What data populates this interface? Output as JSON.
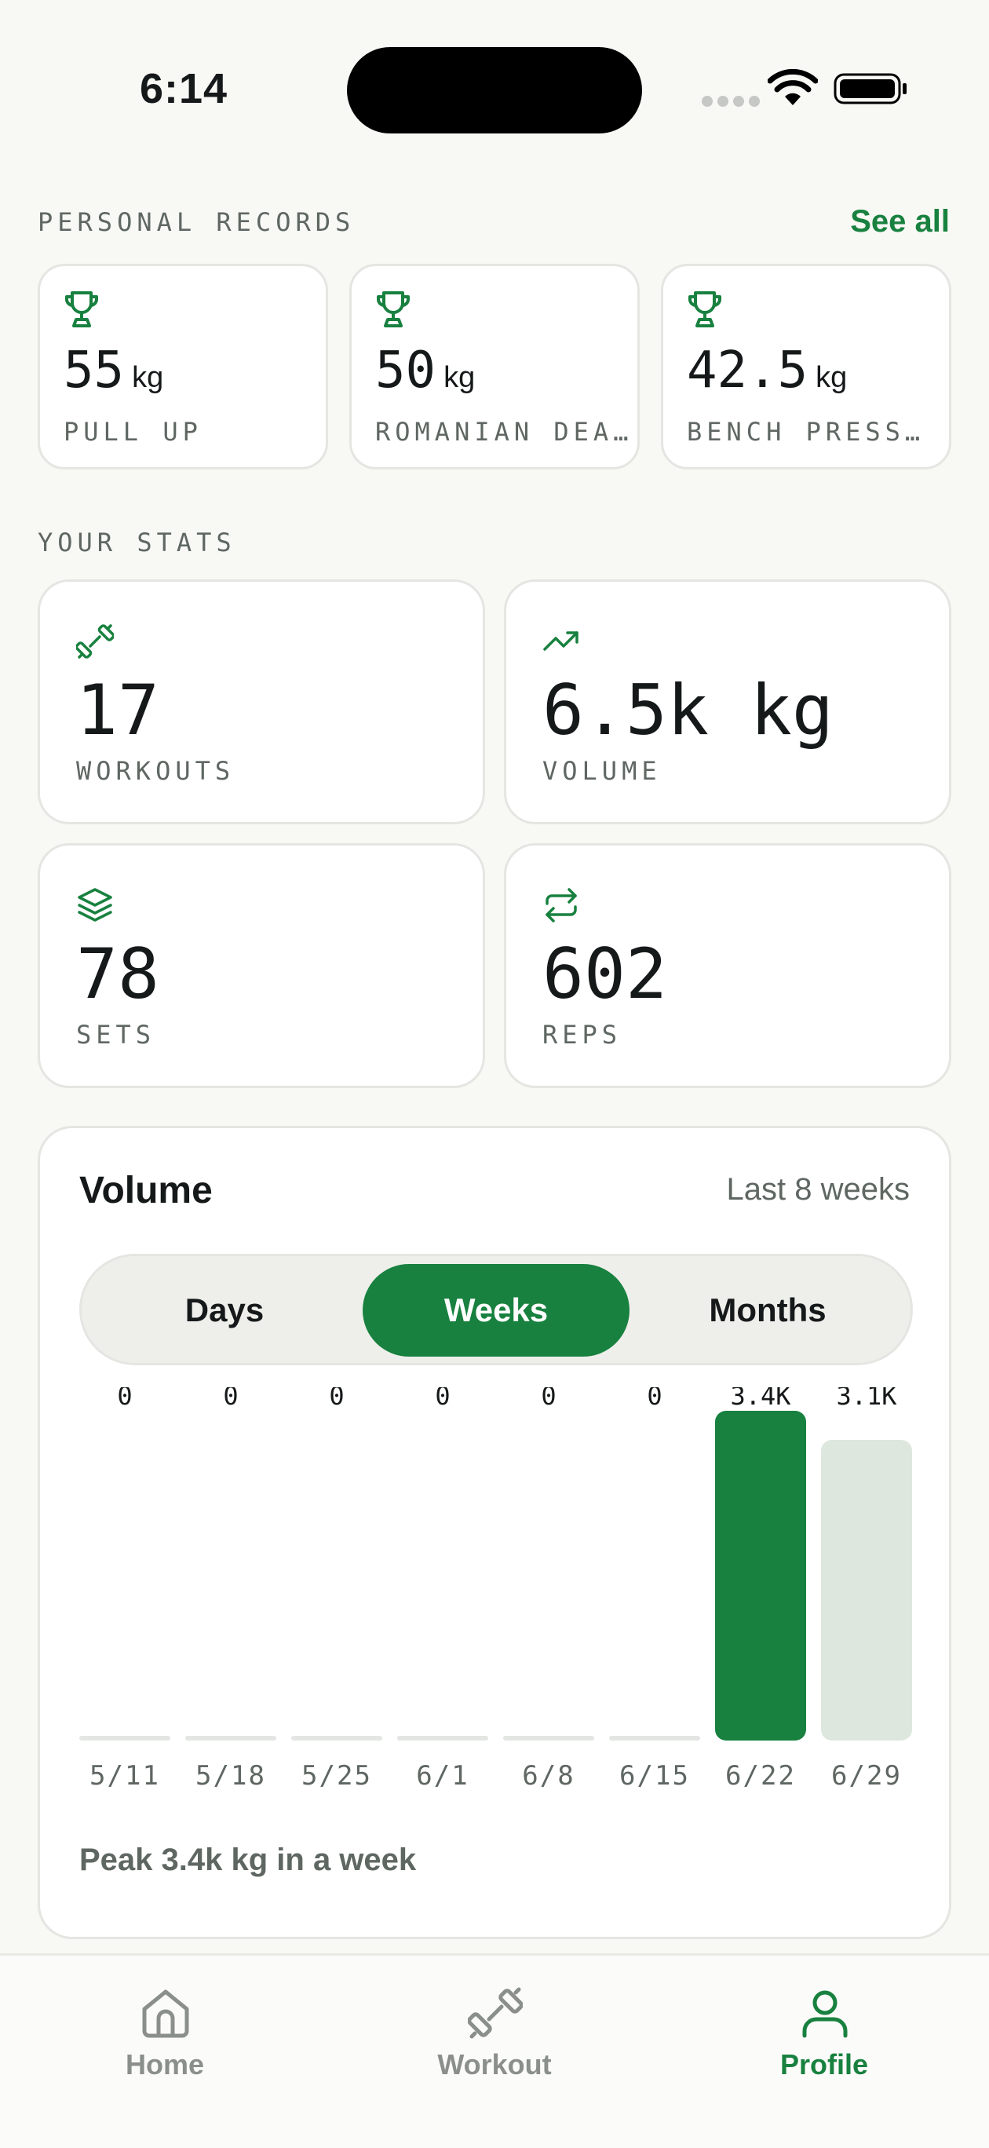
{
  "status": {
    "time": "6:14"
  },
  "records": {
    "title": "PERSONAL RECORDS",
    "see_all": "See all",
    "items": [
      {
        "value": "55",
        "unit": "kg",
        "name": "PULL UP"
      },
      {
        "value": "50",
        "unit": "kg",
        "name": "ROMANIAN DEA…"
      },
      {
        "value": "42.5",
        "unit": "kg",
        "name": "BENCH PRESS…"
      }
    ]
  },
  "stats": {
    "title": "YOUR STATS",
    "items": [
      {
        "value": "17",
        "label": "WORKOUTS",
        "icon": "dumbbell-icon"
      },
      {
        "value": "6.5k kg",
        "label": "VOLUME",
        "icon": "trending-up-icon"
      },
      {
        "value": "78",
        "label": "SETS",
        "icon": "layers-icon"
      },
      {
        "value": "602",
        "label": "REPS",
        "icon": "repeat-icon"
      }
    ]
  },
  "volume": {
    "title": "Volume",
    "range": "Last 8 weeks",
    "tabs": [
      "Days",
      "Weeks",
      "Months"
    ],
    "active_tab": "Weeks",
    "peak": "Peak 3.4k kg in a week"
  },
  "chart_data": {
    "type": "bar",
    "categories": [
      "5/11",
      "5/18",
      "5/25",
      "6/1",
      "6/8",
      "6/15",
      "6/22",
      "6/29"
    ],
    "values": [
      0,
      0,
      0,
      0,
      0,
      0,
      3400,
      3100
    ],
    "value_labels": [
      "0",
      "0",
      "0",
      "0",
      "0",
      "0",
      "3.4K",
      "3.1K"
    ],
    "highlight_index": 6,
    "colors": {
      "highlight": "#18813f",
      "normal": "#dde7dd",
      "empty": "#e3e6e2"
    }
  },
  "tabbar": {
    "items": [
      {
        "label": "Home",
        "icon": "home-icon"
      },
      {
        "label": "Workout",
        "icon": "dumbbell-icon"
      },
      {
        "label": "Profile",
        "icon": "user-icon"
      }
    ],
    "active": "Profile"
  },
  "colors": {
    "accent": "#18813f",
    "background": "#f8f8f4",
    "card": "#ffffff",
    "muted": "#5f6762"
  }
}
